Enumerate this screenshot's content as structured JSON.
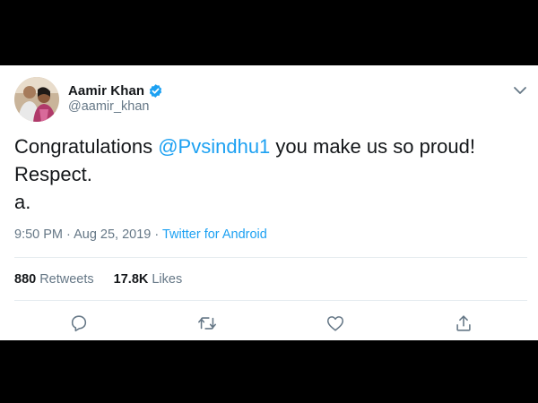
{
  "tweet": {
    "author": {
      "display_name": "Aamir Khan",
      "handle": "@aamir_khan",
      "verified": true
    },
    "text": {
      "prefix": "Congratulations ",
      "mention": "@Pvsindhu1",
      "suffix": " you make us so proud!",
      "line2": "Respect.",
      "line3": "a."
    },
    "timestamp": "9:50 PM · Aug 25, 2019",
    "separator": " · ",
    "source": "Twitter for Android",
    "stats": {
      "retweets_count": "880",
      "retweets_label": "Retweets",
      "likes_count": "17.8K",
      "likes_label": "Likes"
    },
    "actions": [
      "reply-icon",
      "retweet-icon",
      "like-icon",
      "share-icon"
    ]
  },
  "colors": {
    "accent": "#1da1f2",
    "text": "#14171a",
    "secondary": "#657786",
    "background": "#000000",
    "card": "#ffffff"
  }
}
